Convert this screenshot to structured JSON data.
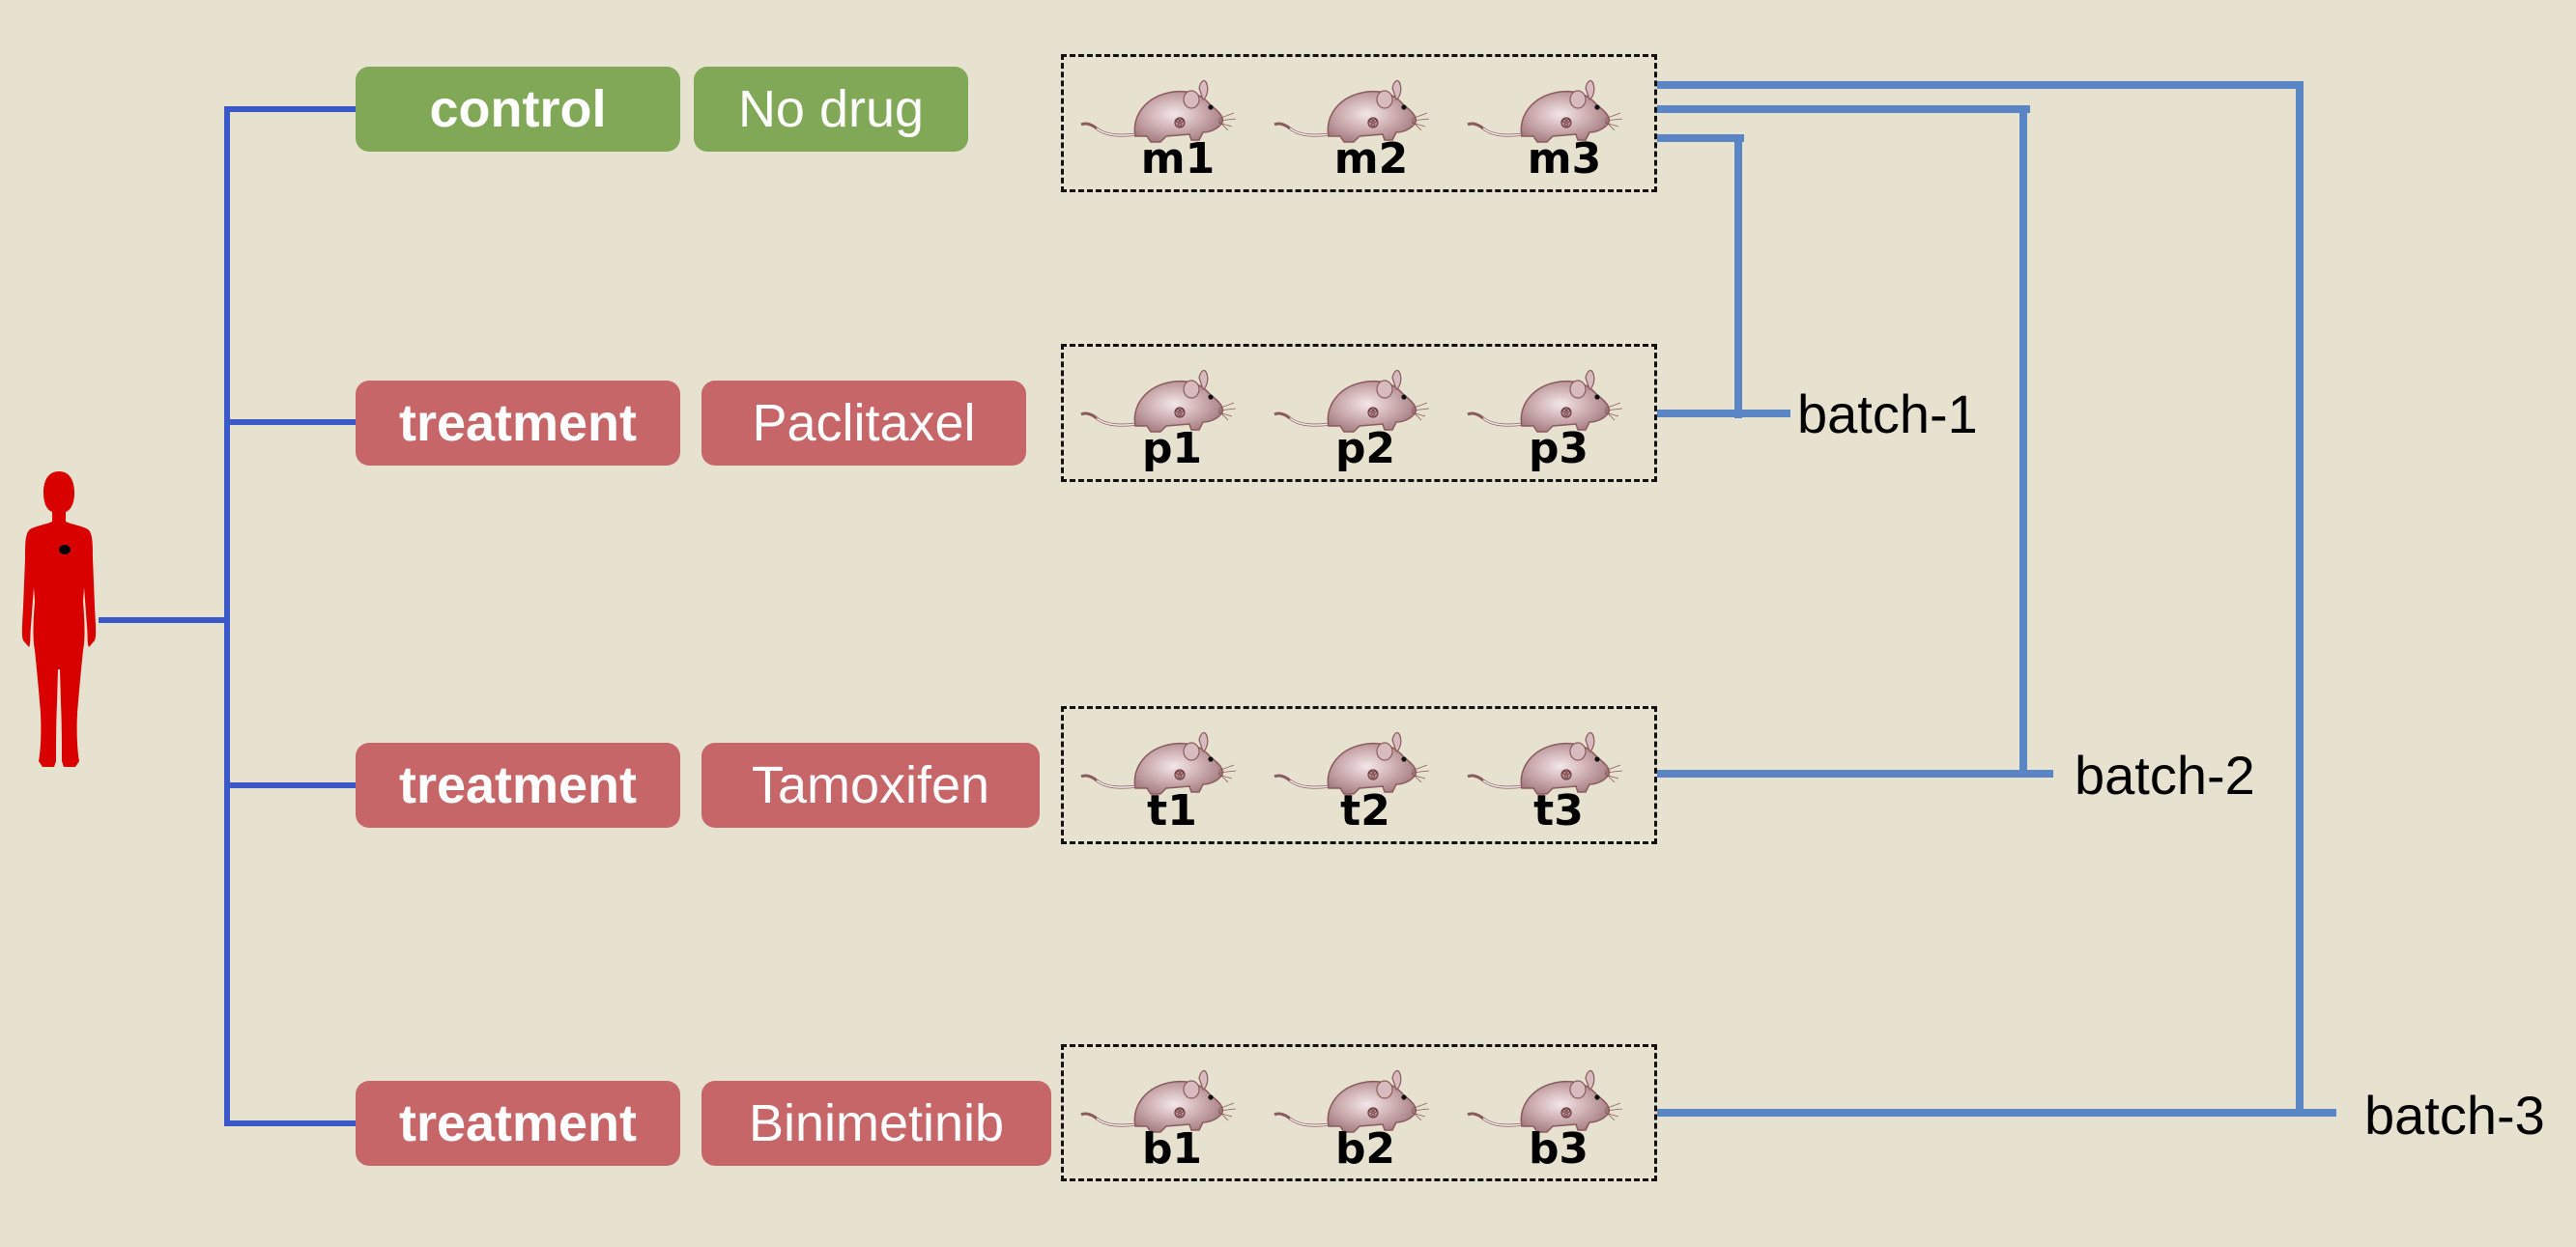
{
  "diagram": {
    "source_icon": "human-female-silhouette-with-tumor",
    "groups": [
      {
        "group_label": "control",
        "drug_label": "No drug",
        "color": "#80a857",
        "mice": [
          "m1",
          "m2",
          "m3"
        ]
      },
      {
        "group_label": "treatment",
        "drug_label": "Paclitaxel",
        "color": "#c66669",
        "mice": [
          "p1",
          "p2",
          "p3"
        ]
      },
      {
        "group_label": "treatment",
        "drug_label": "Tamoxifen",
        "color": "#c66669",
        "mice": [
          "t1",
          "t2",
          "t3"
        ]
      },
      {
        "group_label": "treatment",
        "drug_label": "Binimetinib",
        "color": "#c66669",
        "mice": [
          "b1",
          "b2",
          "b3"
        ]
      }
    ],
    "batches": [
      {
        "label": "batch-1",
        "members": [
          "No drug",
          "Paclitaxel"
        ]
      },
      {
        "label": "batch-2",
        "members": [
          "No drug",
          "Tamoxifen"
        ]
      },
      {
        "label": "batch-3",
        "members": [
          "No drug",
          "Binimetinib"
        ]
      }
    ],
    "colors": {
      "background": "#e7e2cf",
      "tree_line": "#3a58c8",
      "batch_line": "#5b86c6",
      "control": "#80a857",
      "treatment": "#c66669",
      "human": "#d90000"
    }
  }
}
